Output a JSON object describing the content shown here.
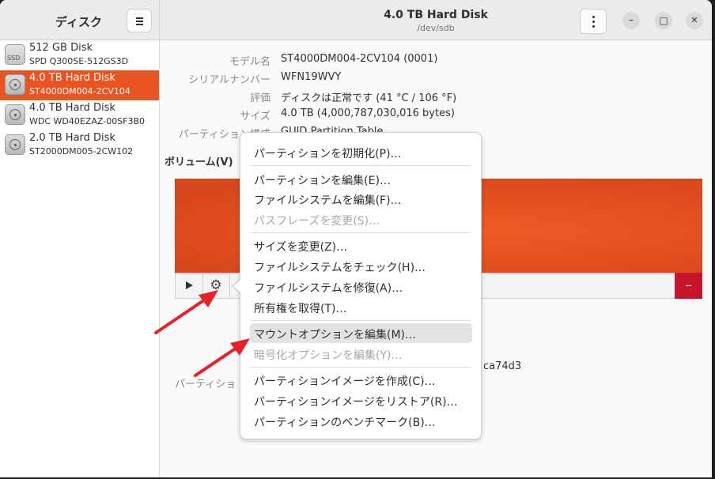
{
  "sidebar": {
    "title": "ディスク",
    "disks": [
      {
        "name": "512 GB Disk",
        "model": "SPD Q300SE-512GS3D",
        "icon": "ssd-icon",
        "icon_label": "SSD"
      },
      {
        "name": "4.0 TB Hard Disk",
        "model": "ST4000DM004-2CV104",
        "icon": "hard-disk-icon",
        "selected": true
      },
      {
        "name": "4.0 TB Hard Disk",
        "model": "WDC WD40EZAZ-00SF3B0",
        "icon": "hard-disk-icon"
      },
      {
        "name": "2.0 TB Hard Disk",
        "model": "ST2000DM005-2CW102",
        "icon": "hard-disk-icon"
      }
    ]
  },
  "header": {
    "title": "4.0 TB Hard Disk",
    "subtitle": "/dev/sdb",
    "minimize": "–",
    "maximize": "□",
    "close": "✕"
  },
  "properties": [
    {
      "label": "モデル名",
      "value": "ST4000DM004-2CV104 (0001)"
    },
    {
      "label": "シリアルナンバー",
      "value": "WFN19WVY"
    },
    {
      "label": "評価",
      "value": "ディスクは正常です (41 °C / 106 °F)"
    },
    {
      "label": "サイズ",
      "value": "4.0 TB (4,000,787,030,016 bytes)"
    },
    {
      "label": "パーティション構成",
      "value": "GUID Partition Table"
    }
  ],
  "volumes": {
    "label": "ボリューム(V)",
    "partition_label_partial": "パーティショ",
    "uuid_partial": "ca74d3",
    "minus": "–",
    "gear": "⚙"
  },
  "menu": {
    "items": [
      {
        "label": "パーティションを初期化(P)…",
        "enabled": true
      },
      {
        "label": "パーティションを編集(E)…",
        "enabled": true
      },
      {
        "label": "ファイルシステムを編集(F)…",
        "enabled": true
      },
      {
        "label": "パスフレーズを変更(S)…",
        "enabled": false
      },
      {
        "label": "サイズを変更(Z)…",
        "enabled": true
      },
      {
        "label": "ファイルシステムをチェック(H)…",
        "enabled": true
      },
      {
        "label": "ファイルシステムを修復(A)…",
        "enabled": true
      },
      {
        "label": "所有権を取得(T)…",
        "enabled": true
      },
      {
        "label": "マウントオプションを編集(M)…",
        "enabled": true,
        "highlighted": true
      },
      {
        "label": "暗号化オプションを編集(Y)…",
        "enabled": false
      },
      {
        "label": "パーティションイメージを作成(C)…",
        "enabled": true
      },
      {
        "label": "パーティションイメージをリストア(R)…",
        "enabled": true
      },
      {
        "label": "パーティションのベンチマーク(B)…",
        "enabled": true
      }
    ]
  },
  "colors": {
    "accent": "#e95420",
    "danger": "#c7162b",
    "annotation_arrow": "#e8202a"
  }
}
